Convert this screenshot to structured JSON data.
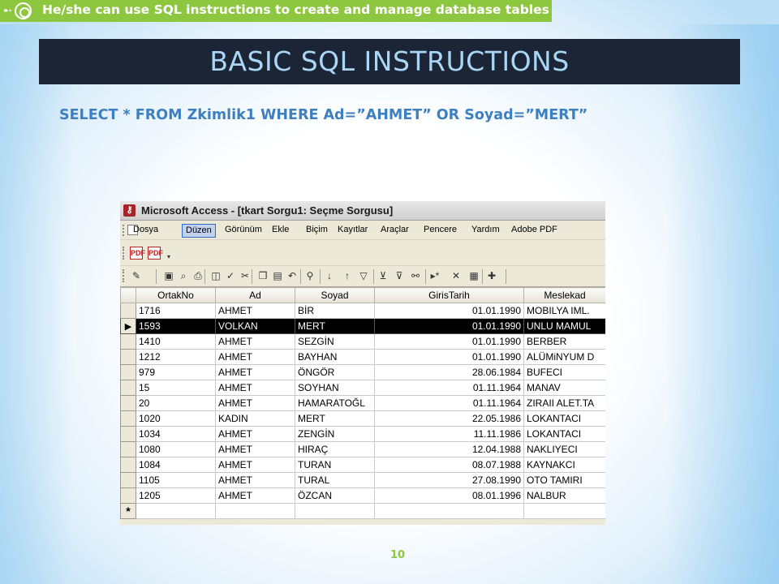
{
  "slide": {
    "objective": "He/she can use SQL instructions to create and manage database tables",
    "title": "BASIC SQL INSTRUCTIONS",
    "sql_statement": "SELECT * FROM Zkimlik1 WHERE Ad=”AHMET” OR Soyad=”MERT”",
    "page_number": "10",
    "colors": {
      "banner": "#8dc63f",
      "title_bar": "#1c2536",
      "title_text": "#a9d6f5",
      "sql_text": "#3d7fc0"
    }
  },
  "access": {
    "window_title": "Microsoft Access - [tkart Sorgu1: Seçme Sorgusu]",
    "menu": [
      {
        "label": "Dosya"
      },
      {
        "label": "Düzen",
        "active": true
      },
      {
        "label": "Görünüm"
      },
      {
        "label": "Ekle"
      },
      {
        "label": "Biçim"
      },
      {
        "label": "Kayıtlar"
      },
      {
        "label": "Araçlar"
      },
      {
        "label": "Pencere"
      },
      {
        "label": "Yardım"
      },
      {
        "label": "Adobe PDF"
      }
    ],
    "toolbar_icons": [
      "design-view-icon",
      "save-icon",
      "search-icon",
      "print-icon",
      "print-preview-icon",
      "spelling-icon",
      "cut-icon",
      "copy-icon",
      "paste-icon",
      "undo-icon",
      "hyperlink-icon",
      "sort-ascending-icon",
      "sort-descending-icon",
      "filter-by-selection-icon",
      "filter-by-form-icon",
      "apply-filter-icon",
      "find-icon",
      "new-record-icon",
      "delete-record-icon",
      "database-window-icon",
      "new-object-icon"
    ],
    "grid": {
      "columns": [
        "OrtakNo",
        "Ad",
        "Soyad",
        "GirisTarih",
        "Meslekad"
      ],
      "current_row_index": 1,
      "rows": [
        [
          "1716",
          "AHMET",
          "BİR",
          "01.01.1990",
          "MOBILYA IML."
        ],
        [
          "1593",
          "VOLKAN",
          "MERT",
          "01.01.1990",
          "UNLU MAMUL"
        ],
        [
          "1410",
          "AHMET",
          "SEZGİN",
          "01.01.1990",
          "BERBER"
        ],
        [
          "1212",
          "AHMET",
          "BAYHAN",
          "01.01.1990",
          "ALÜMiNYUM D"
        ],
        [
          "979",
          "AHMET",
          "ÖNGÖR",
          "28.06.1984",
          "BUFECI"
        ],
        [
          "15",
          "AHMET",
          "SOYHAN",
          "01.11.1964",
          "MANAV"
        ],
        [
          "20",
          "AHMET",
          "HAMARATOĞL",
          "01.11.1964",
          "ZIRAII ALET.TA"
        ],
        [
          "1020",
          "KADIN",
          "MERT",
          "22.05.1986",
          "LOKANTACI"
        ],
        [
          "1034",
          "AHMET",
          "ZENGİN",
          "11.11.1986",
          "LOKANTACI"
        ],
        [
          "1080",
          "AHMET",
          "HIRAÇ",
          "12.04.1988",
          "NAKLIYECI"
        ],
        [
          "1084",
          "AHMET",
          "TURAN",
          "08.07.1988",
          "KAYNAKCI"
        ],
        [
          "1105",
          "AHMET",
          "TURAL",
          "27.08.1990",
          "OTO TAMIRI"
        ],
        [
          "1205",
          "AHMET",
          "ÖZCAN",
          "08.01.1996",
          "NALBUR"
        ]
      ],
      "current_marker": "▶",
      "new_row_marker": "*"
    }
  }
}
